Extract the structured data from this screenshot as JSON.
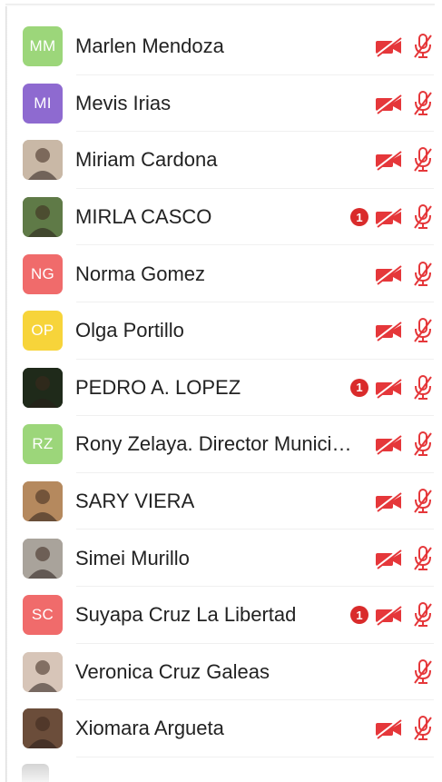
{
  "colors": {
    "muted_red": "#e5373a",
    "badge_red": "#d92b2b",
    "text": "#222222"
  },
  "participants": [
    {
      "name": "Marlen Mendoza",
      "initials": "MM",
      "avatar_color": "#9cd67a",
      "badge": "",
      "video_off": true,
      "mic_off": true
    },
    {
      "name": "Mevis Irias",
      "initials": "MI",
      "avatar_color": "#8e6ad0",
      "badge": "",
      "video_off": true,
      "mic_off": true
    },
    {
      "name": "Miriam Cardona",
      "initials": "",
      "avatar_color": "#c9b8a6",
      "badge": "",
      "video_off": true,
      "mic_off": true
    },
    {
      "name": "MIRLA CASCO",
      "initials": "",
      "avatar_color": "#5f7a47",
      "badge": "1",
      "video_off": true,
      "mic_off": true
    },
    {
      "name": "Norma Gomez",
      "initials": "NG",
      "avatar_color": "#f06b6b",
      "badge": "",
      "video_off": true,
      "mic_off": true
    },
    {
      "name": "Olga Portillo",
      "initials": "OP",
      "avatar_color": "#f7d43a",
      "badge": "",
      "video_off": true,
      "mic_off": true
    },
    {
      "name": "PEDRO A. LOPEZ",
      "initials": "",
      "avatar_color": "#1f2a1a",
      "badge": "1",
      "video_off": true,
      "mic_off": true
    },
    {
      "name": "Rony Zelaya. Director Municipal",
      "initials": "RZ",
      "avatar_color": "#9cd67a",
      "badge": "",
      "video_off": true,
      "mic_off": true
    },
    {
      "name": "SARY VIERA",
      "initials": "",
      "avatar_color": "#b5895e",
      "badge": "",
      "video_off": true,
      "mic_off": true
    },
    {
      "name": "Simei Murillo",
      "initials": "",
      "avatar_color": "#a9a39b",
      "badge": "",
      "video_off": true,
      "mic_off": true
    },
    {
      "name": "Suyapa Cruz La Libertad",
      "initials": "SC",
      "avatar_color": "#f06b6b",
      "badge": "1",
      "video_off": true,
      "mic_off": true
    },
    {
      "name": "Veronica Cruz Galeas",
      "initials": "",
      "avatar_color": "#d7c5b8",
      "badge": "",
      "video_off": false,
      "mic_off": true
    },
    {
      "name": "Xiomara Argueta",
      "initials": "",
      "avatar_color": "#6b4d3a",
      "badge": "",
      "video_off": true,
      "mic_off": true
    }
  ]
}
